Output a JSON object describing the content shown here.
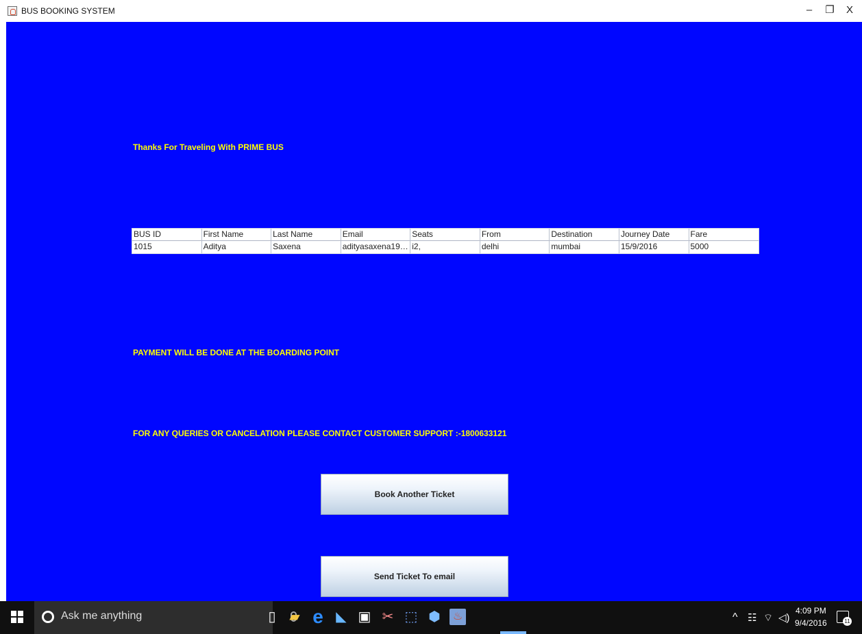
{
  "window": {
    "title": "BUS BOOKING SYSTEM",
    "controls": {
      "minimize": "–",
      "restore": "❐",
      "close": "X"
    }
  },
  "messages": {
    "thanks": "Thanks For Traveling With PRIME BUS",
    "payment": "PAYMENT WILL BE DONE AT THE BOARDING POINT",
    "support": "FOR ANY QUERIES OR CANCELATION PLEASE CONTACT CUSTOMER SUPPORT :-1800633121"
  },
  "ticket_table": {
    "columns": [
      "BUS ID",
      "First Name",
      "Last Name",
      "Email",
      "Seats",
      "From",
      "Destination",
      "Journey Date",
      "Fare"
    ],
    "rows": [
      [
        "1015",
        "Aditya",
        "Saxena",
        "adityasaxena199...",
        "i2,",
        "delhi",
        "mumbai",
        "15/9/2016",
        "5000"
      ]
    ]
  },
  "buttons": {
    "book_another": "Book Another Ticket",
    "send_email": "Send Ticket To email"
  },
  "taskbar": {
    "search_placeholder": "Ask me anything",
    "icons": [
      "windows-start-icon",
      "cortana-icon",
      "microphone-icon",
      "task-view-icon",
      "file-explorer-icon",
      "edge-icon",
      "app-icon",
      "store-icon",
      "snipping-tool-icon",
      "image-tool-icon",
      "virtualbox-icon",
      "java-icon"
    ],
    "tray": {
      "time": "4:09 PM",
      "date": "9/4/2016",
      "notifications": "11"
    }
  },
  "colors": {
    "background": "#0006ff",
    "message_text": "#ffff00",
    "taskbar": "#101010"
  }
}
